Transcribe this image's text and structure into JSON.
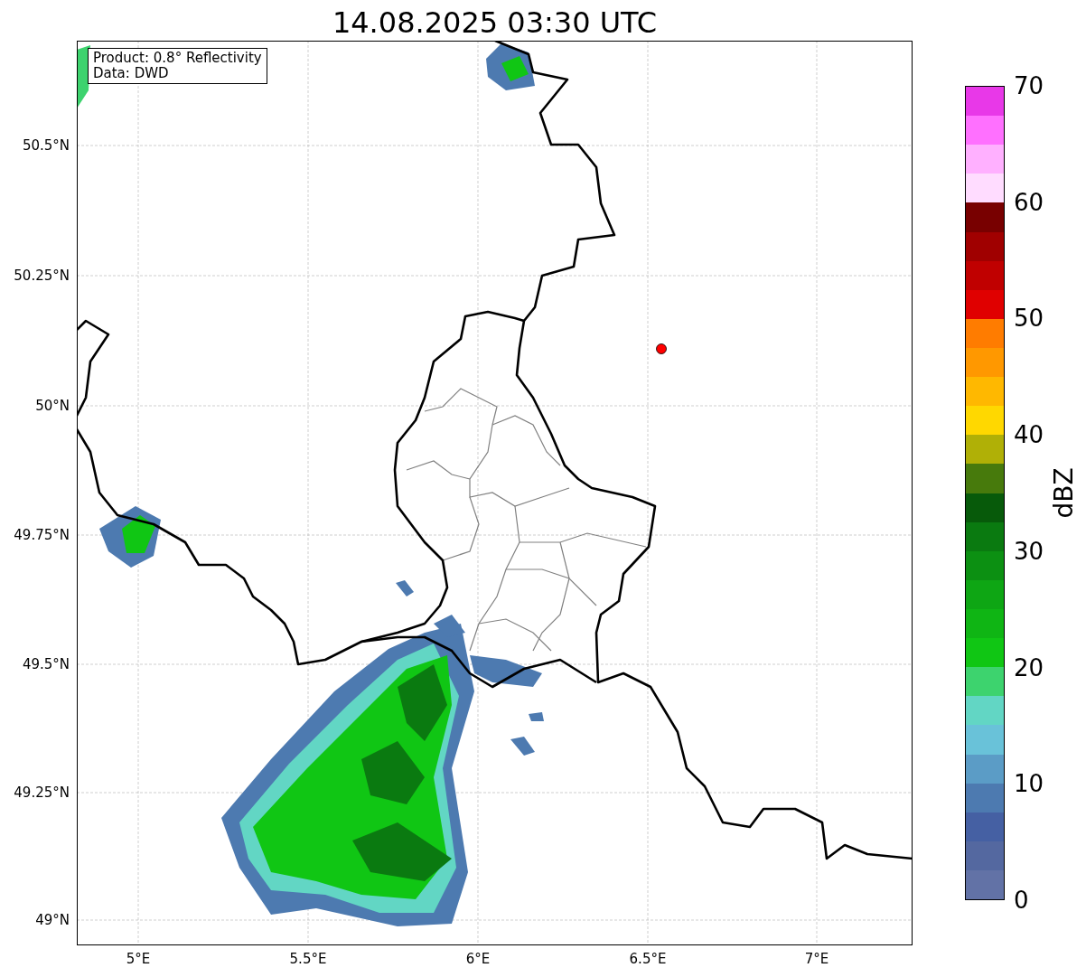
{
  "title": "14.08.2025 03:30 UTC",
  "map": {
    "info_box": [
      "Product: 0.8° Reflectivity",
      "Data: DWD"
    ],
    "yticks": [
      "50.5°N",
      "50.25°N",
      "50°N",
      "49.75°N",
      "49.5°N",
      "49.25°N",
      "49°N"
    ],
    "xticks": [
      "5°E",
      "5.5°E",
      "6°E",
      "6.5°E",
      "7°E"
    ]
  },
  "colorbar": {
    "label": "dBZ",
    "ticks": [
      "70",
      "60",
      "50",
      "40",
      "30",
      "20",
      "10",
      "0"
    ],
    "bands": [
      {
        "color": "#e838e8"
      },
      {
        "color": "#ff70ff"
      },
      {
        "color": "#ffb0ff"
      },
      {
        "color": "#ffdcff"
      },
      {
        "color": "#780000"
      },
      {
        "color": "#a00000"
      },
      {
        "color": "#c00000"
      },
      {
        "color": "#e00000"
      },
      {
        "color": "#ff7c00"
      },
      {
        "color": "#ff9800"
      },
      {
        "color": "#ffb800"
      },
      {
        "color": "#ffd800"
      },
      {
        "color": "#b0b006"
      },
      {
        "color": "#477a0c"
      },
      {
        "color": "#075a0a"
      },
      {
        "color": "#0a7a10"
      },
      {
        "color": "#0c9012"
      },
      {
        "color": "#0ea614"
      },
      {
        "color": "#0fb514"
      },
      {
        "color": "#10c614"
      },
      {
        "color": "#3dd36e"
      },
      {
        "color": "#62d6c4"
      },
      {
        "color": "#69c2d9"
      },
      {
        "color": "#5b9cc6"
      },
      {
        "color": "#4d7ab0"
      },
      {
        "color": "#4560a3"
      },
      {
        "color": "#5468a0"
      },
      {
        "color": "#6272a6"
      }
    ]
  }
}
